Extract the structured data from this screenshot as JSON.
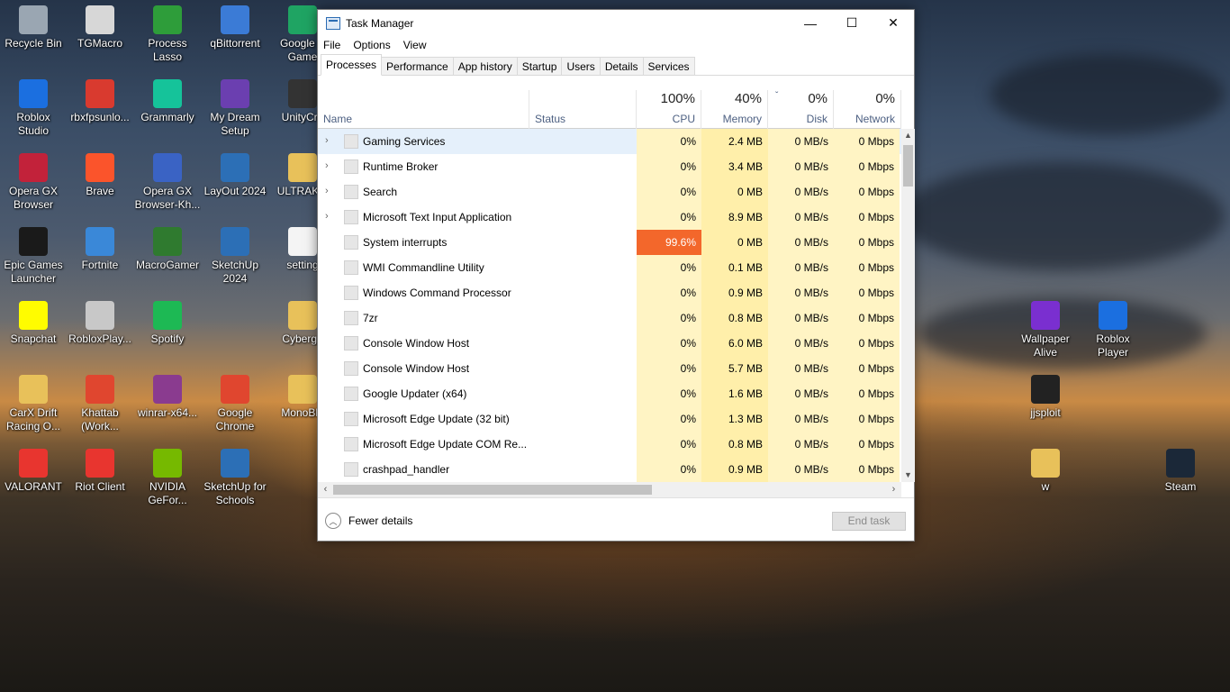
{
  "desktop_icons": [
    {
      "label": "Recycle Bin",
      "icon": "recycle-bin-icon",
      "color": "#9aa6b2"
    },
    {
      "label": "TGMacro",
      "icon": "tgmacro-icon",
      "color": "#d7d7d7"
    },
    {
      "label": "Process\nLasso",
      "icon": "process-lasso-icon",
      "color": "#2e9d3a"
    },
    {
      "label": "qBittorrent",
      "icon": "qbittorrent-icon",
      "color": "#3b7bd6"
    },
    {
      "label": "Google P\nGame",
      "icon": "google-play-games-icon",
      "color": "#1fa463"
    },
    {
      "label": "Roblox\nStudio",
      "icon": "roblox-studio-icon",
      "color": "#1b6fe0"
    },
    {
      "label": "rbxfpsunlo...",
      "icon": "rbxfpsunlocker-icon",
      "color": "#d93a2f"
    },
    {
      "label": "Grammarly",
      "icon": "grammarly-icon",
      "color": "#15c39a"
    },
    {
      "label": "My Dream\nSetup",
      "icon": "my-dream-setup-icon",
      "color": "#6b3fb0"
    },
    {
      "label": "UnityCra",
      "icon": "unity-icon",
      "color": "#333333"
    },
    {
      "label": "Opera GX\nBrowser",
      "icon": "opera-gx-icon",
      "color": "#c2223a"
    },
    {
      "label": "Brave",
      "icon": "brave-icon",
      "color": "#fb542b"
    },
    {
      "label": "Opera GX\nBrowser-Kh...",
      "icon": "opera-gx-shortcut-icon",
      "color": "#3a63c4"
    },
    {
      "label": "LayOut 2024",
      "icon": "layout-icon",
      "color": "#2c6fb6"
    },
    {
      "label": "ULTRAKIL",
      "icon": "folder-icon",
      "color": "#e8c15a"
    },
    {
      "label": "Epic Games\nLauncher",
      "icon": "epic-games-icon",
      "color": "#1a1a1a"
    },
    {
      "label": "Fortnite",
      "icon": "fortnite-icon",
      "color": "#3a88d8"
    },
    {
      "label": "MacroGamer",
      "icon": "macrogamer-icon",
      "color": "#2f7a2f"
    },
    {
      "label": "SketchUp\n2024",
      "icon": "sketchup-icon",
      "color": "#2c6fb6"
    },
    {
      "label": "setting",
      "icon": "file-icon",
      "color": "#f4f4f4"
    },
    {
      "label": "Snapchat",
      "icon": "snapchat-icon",
      "color": "#fffc00"
    },
    {
      "label": "RobloxPlay...",
      "icon": "roblox-player-icon",
      "color": "#c8c8c8"
    },
    {
      "label": "Spotify",
      "icon": "spotify-icon",
      "color": "#1db954"
    },
    {
      "label": "Cybergri",
      "icon": "folder-icon",
      "color": "#e8c15a"
    },
    {
      "label": "CarX Drift\nRacing O...",
      "icon": "folder-icon",
      "color": "#e8c15a"
    },
    {
      "label": "Khattab\n(Work...",
      "icon": "chrome-icon",
      "color": "#e0462f"
    },
    {
      "label": "winrar-x64...",
      "icon": "winrar-icon",
      "color": "#8a3b8f"
    },
    {
      "label": "Google\nChrome",
      "icon": "chrome-icon",
      "color": "#e0462f"
    },
    {
      "label": "MonoBle",
      "icon": "folder-icon",
      "color": "#e8c15a"
    },
    {
      "label": "VALORANT",
      "icon": "valorant-icon",
      "color": "#e8352f"
    },
    {
      "label": "Riot Client",
      "icon": "riot-client-icon",
      "color": "#e8352f"
    },
    {
      "label": "NVIDIA\nGeFor...",
      "icon": "nvidia-icon",
      "color": "#76b900"
    },
    {
      "label": "SketchUp for\nSchools",
      "icon": "sketchup-schools-icon",
      "color": "#2c6fb6"
    },
    {
      "label": "Wallpaper\nAlive",
      "icon": "wallpaper-alive-icon",
      "color": "#7a2fd0"
    },
    {
      "label": "Roblox\nPlayer",
      "icon": "roblox-player-icon",
      "color": "#1b6fe0"
    },
    {
      "label": "jjsploit",
      "icon": "jjsploit-icon",
      "color": "#222222"
    },
    {
      "label": "w",
      "icon": "folder-icon",
      "color": "#e8c15a"
    },
    {
      "label": "Steam",
      "icon": "steam-icon",
      "color": "#1b2838"
    }
  ],
  "window": {
    "title": "Task Manager",
    "minimize": "—",
    "maximize": "☐",
    "close": "✕"
  },
  "menu": [
    "File",
    "Options",
    "View"
  ],
  "tabs": [
    "Processes",
    "Performance",
    "App history",
    "Startup",
    "Users",
    "Details",
    "Services"
  ],
  "active_tab": "Processes",
  "columns": {
    "name": "Name",
    "status": "Status",
    "cpu_pct": "100%",
    "cpu": "CPU",
    "mem_pct": "40%",
    "mem": "Memory",
    "disk_pct": "0%",
    "disk": "Disk",
    "net_pct": "0%",
    "net": "Network",
    "sort_indicator": "ˇ"
  },
  "rows": [
    {
      "expand": "›",
      "name": "Gaming Services",
      "cpu": "0%",
      "mem": "2.4 MB",
      "disk": "0 MB/s",
      "net": "0 Mbps"
    },
    {
      "expand": "›",
      "name": "Runtime Broker",
      "cpu": "0%",
      "mem": "3.4 MB",
      "disk": "0 MB/s",
      "net": "0 Mbps"
    },
    {
      "expand": "›",
      "name": "Search",
      "cpu": "0%",
      "mem": "0 MB",
      "disk": "0 MB/s",
      "net": "0 Mbps"
    },
    {
      "expand": "›",
      "name": "Microsoft Text Input Application",
      "cpu": "0%",
      "mem": "8.9 MB",
      "disk": "0 MB/s",
      "net": "0 Mbps"
    },
    {
      "expand": "",
      "name": "System interrupts",
      "cpu": "99.6%",
      "mem": "0 MB",
      "disk": "0 MB/s",
      "net": "0 Mbps"
    },
    {
      "expand": "",
      "name": "WMI Commandline Utility",
      "cpu": "0%",
      "mem": "0.1 MB",
      "disk": "0 MB/s",
      "net": "0 Mbps"
    },
    {
      "expand": "",
      "name": "Windows Command Processor",
      "cpu": "0%",
      "mem": "0.9 MB",
      "disk": "0 MB/s",
      "net": "0 Mbps"
    },
    {
      "expand": "",
      "name": "7zr",
      "cpu": "0%",
      "mem": "0.8 MB",
      "disk": "0 MB/s",
      "net": "0 Mbps"
    },
    {
      "expand": "",
      "name": "Console Window Host",
      "cpu": "0%",
      "mem": "6.0 MB",
      "disk": "0 MB/s",
      "net": "0 Mbps"
    },
    {
      "expand": "",
      "name": "Console Window Host",
      "cpu": "0%",
      "mem": "5.7 MB",
      "disk": "0 MB/s",
      "net": "0 Mbps"
    },
    {
      "expand": "",
      "name": "Google Updater (x64)",
      "cpu": "0%",
      "mem": "1.6 MB",
      "disk": "0 MB/s",
      "net": "0 Mbps"
    },
    {
      "expand": "",
      "name": "Microsoft Edge Update (32 bit)",
      "cpu": "0%",
      "mem": "1.3 MB",
      "disk": "0 MB/s",
      "net": "0 Mbps"
    },
    {
      "expand": "",
      "name": "Microsoft Edge Update COM Re...",
      "cpu": "0%",
      "mem": "0.8 MB",
      "disk": "0 MB/s",
      "net": "0 Mbps"
    },
    {
      "expand": "",
      "name": "crashpad_handler",
      "cpu": "0%",
      "mem": "0.9 MB",
      "disk": "0 MB/s",
      "net": "0 Mbps"
    }
  ],
  "hot_color": "#f3672b",
  "footer": {
    "fewer_details": "Fewer details",
    "end_task": "End task"
  }
}
